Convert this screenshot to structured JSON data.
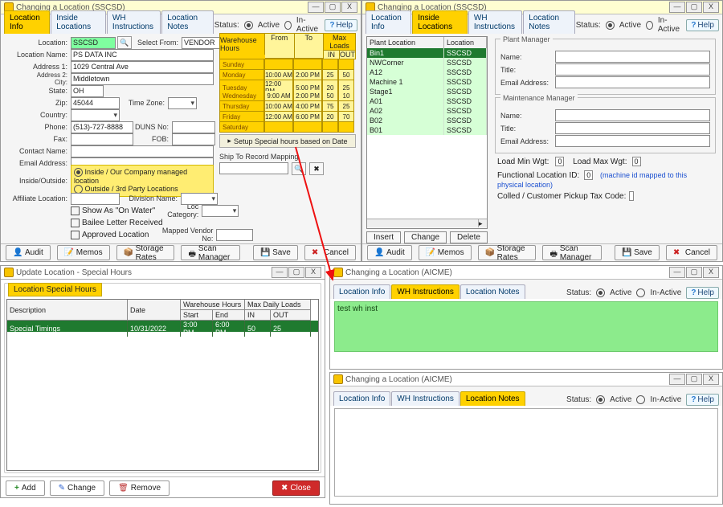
{
  "win_changing": "Changing a Location  (SSCSD)",
  "win_changing2": "Changing a Location  (AICME)",
  "win_specialhours": "Update Location - Special Hours",
  "tbtn_min": "—",
  "tbtn_max": "▢",
  "tbtn_close": "X",
  "tabs": {
    "locinfo": "Location Info",
    "inside": "Inside Locations",
    "whinst": "WH Instructions",
    "locnotes": "Location Notes"
  },
  "status": {
    "label": "Status:",
    "active": "Active",
    "inactive": "In-Active"
  },
  "help": "Help",
  "help_icon": "?",
  "labels": {
    "location": "Location:",
    "selectfrom": "Select From:",
    "locname": "Location Name:",
    "addr1": "Address 1:",
    "addr2": "Address 2:",
    "city": "City:",
    "state": "State:",
    "zip": "Zip:",
    "timezone": "Time Zone:",
    "country": "Country:",
    "phone": "Phone:",
    "duns": "DUNS No:",
    "fax": "Fax:",
    "fob": "FOB:",
    "contact": "Contact Name:",
    "email": "Email Address:",
    "insideoutside": "Inside/Outside:",
    "afloc": "Affiliate Location:",
    "divname": "Division Name:",
    "showwater": "Show As \"On Water\"",
    "loccat": "Loc Category:",
    "bailee": "Bailee Letter Received",
    "approved": "Approved Location",
    "mvendor": "Mapped Vendor No:"
  },
  "vals": {
    "location": "SSCSD",
    "vendor": "VENDOR",
    "locname": "PS DATA INC",
    "addr1": "1029 Central Ave",
    "city": "Middletown",
    "state": "OH",
    "zip": "45044",
    "phone": "(513)-727-8888"
  },
  "insideopts": {
    "inside": "Inside / Our Company managed location",
    "outside": "Outside / 3rd Party Locations"
  },
  "wh": {
    "title": "Warehouse Hours",
    "from": "From",
    "to": "To",
    "max": "Max Loads",
    "in": "IN",
    "out": "OUT",
    "days": [
      "Sunday",
      "Monday",
      "Tuesday",
      "Wednesday",
      "Thursday",
      "Friday",
      "Saturday"
    ],
    "rows": [
      [
        "",
        "",
        "",
        ""
      ],
      [
        "10:00 AM",
        "2:00 PM",
        "25",
        "50"
      ],
      [
        "12:00 PM",
        "5:00 PM",
        "20",
        "25"
      ],
      [
        "9:00 AM",
        "2:00 PM",
        "50",
        "10"
      ],
      [
        "10:00 AM",
        "4:00 PM",
        "75",
        "25"
      ],
      [
        "12:00 AM",
        "6:00 PM",
        "20",
        "70"
      ],
      [
        "",
        "",
        "",
        ""
      ]
    ],
    "setup": "Setup Special hours based on Date",
    "shipmap": "Ship To Record Mapping"
  },
  "bbtns": {
    "audit": "Audit",
    "memos": "Memos",
    "storage": "Storage Rates",
    "scan": "Scan Manager",
    "save": "Save",
    "cancel": "Cancel"
  },
  "sh": {
    "group": "Location Special Hours",
    "cols": {
      "desc": "Description",
      "date": "Date",
      "wh": "Warehouse Hours",
      "start": "Start",
      "end": "End",
      "max": "Max Daily Loads",
      "in": "IN",
      "out": "OUT"
    },
    "row": {
      "desc": "Special Timings",
      "date": "10/31/2022",
      "start": "3:00 PM",
      "end": "6:00 PM",
      "in": "50",
      "out": "25"
    },
    "add": "Add",
    "change": "Change",
    "remove": "Remove",
    "close": "Close"
  },
  "plant": {
    "col1": "Plant Location",
    "col2": "Location",
    "rows": [
      {
        "p": "Bin1",
        "l": "SSCSD"
      },
      {
        "p": "NWCorner",
        "l": "SSCSD"
      },
      {
        "p": "A12",
        "l": "SSCSD"
      },
      {
        "p": "Machine 1",
        "l": "SSCSD"
      },
      {
        "p": "Stage1",
        "l": "SSCSD"
      },
      {
        "p": "A01",
        "l": "SSCSD"
      },
      {
        "p": "A02",
        "l": "SSCSD"
      },
      {
        "p": "B02",
        "l": "SSCSD"
      },
      {
        "p": "B01",
        "l": "SSCSD"
      }
    ],
    "insert": "Insert",
    "change": "Change",
    "delete": "Delete"
  },
  "mgr": {
    "plant": "Plant Manager",
    "maint": "Maintenance Manager",
    "name": "Name:",
    "title": "Title:",
    "email": "Email Address:",
    "loadmin": "Load Min Wgt:",
    "loadmax": "Load Max Wgt:",
    "zero": "0",
    "funcloc": "Functional Location ID:",
    "funcnote": "(machine id mapped to this physical location)",
    "colled": "Colled / Customer Pickup Tax Code:"
  },
  "whinst_text": "test wh inst"
}
